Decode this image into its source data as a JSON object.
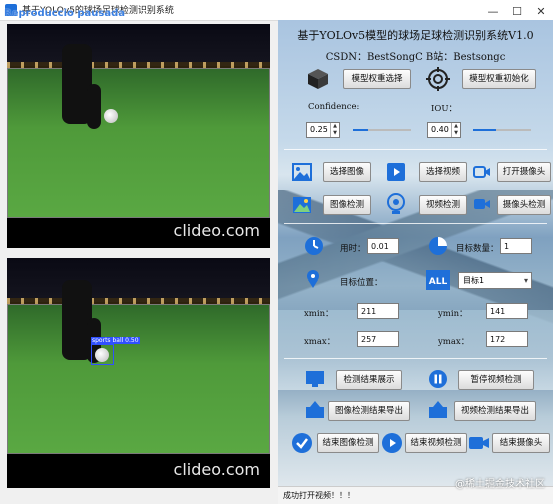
{
  "window": {
    "title": "基于YOLOv5的球场足球检测识别系统",
    "overlay_label": "Reproduccio pausada"
  },
  "panel": {
    "title": "基于YOLOv5模型的球场足球检测识别系统V1.0",
    "subtitle": "CSDN：BestSongC  B站：Bestsongc",
    "model_select_label": "模型权重选择",
    "model_init_label": "模型权重初始化",
    "confidence_label": "Confidence:",
    "confidence_value": "0.25",
    "confidence_level": 0.25,
    "iou_label": "IOU：",
    "iou_value": "0.40",
    "iou_level": 0.4,
    "select_image": "选择图像",
    "select_video": "选择视频",
    "open_camera": "打开摄像头",
    "image_detect": "图像检测",
    "video_detect": "视频检测",
    "camera_detect": "摄像头检测",
    "time_label": "用时：",
    "time_value": "0.01",
    "target_count_label": "目标数量：",
    "target_count_value": "1",
    "target_position_label": "目标位置：",
    "target_select_value": "目标1",
    "xmin_label": "xmin：",
    "xmin_value": "211",
    "ymin_label": "ymin：",
    "ymin_value": "141",
    "xmax_label": "xmax：",
    "xmax_value": "257",
    "ymax_label": "ymax：",
    "ymax_value": "172",
    "show_results": "检测结果展示",
    "pause_video": "暂停视频检测",
    "export_image": "图像检测结果导出",
    "export_video": "视频检测结果导出",
    "end_image": "结束图像检测",
    "end_video": "结束视频检测",
    "end_camera": "结束摄像头",
    "status_text": "成功打开视频！！！"
  },
  "video": {
    "watermark": "clideo.com",
    "detection_label": "sports ball 0.50"
  },
  "site_watermark": "@稀土掘金技术社区",
  "colors": {
    "accent": "#1e6fd9",
    "detection": "#3050ff"
  }
}
